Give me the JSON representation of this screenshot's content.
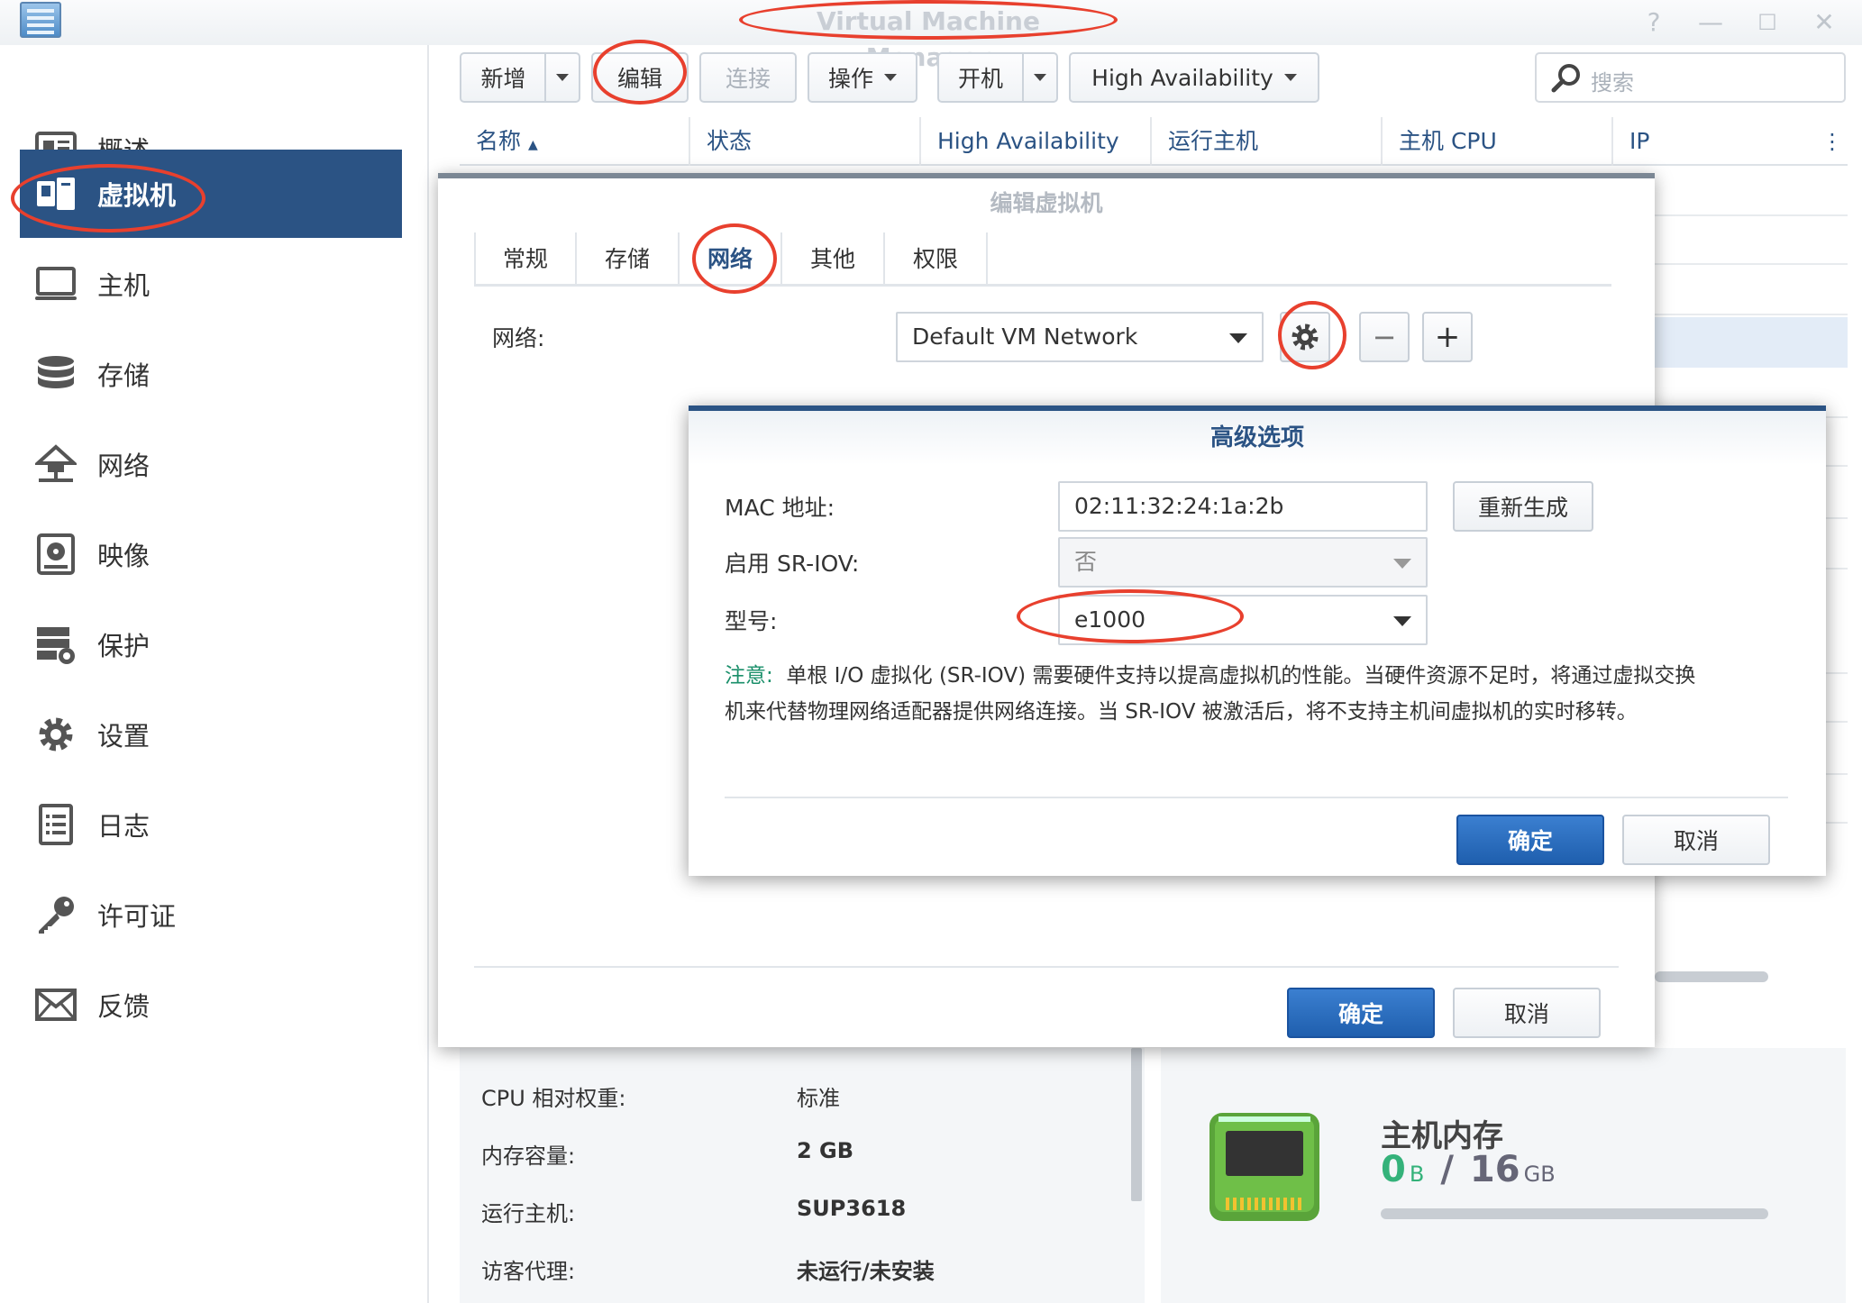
{
  "window": {
    "title": "Virtual Machine Manager",
    "help": "?",
    "minimize": "—",
    "maximize": "☐",
    "close": "✕"
  },
  "sidebar": {
    "items": [
      {
        "label": "概述"
      },
      {
        "label": "虚拟机"
      },
      {
        "label": "主机"
      },
      {
        "label": "存储"
      },
      {
        "label": "网络"
      },
      {
        "label": "映像"
      },
      {
        "label": "保护"
      },
      {
        "label": "设置"
      },
      {
        "label": "日志"
      },
      {
        "label": "许可证"
      },
      {
        "label": "反馈"
      }
    ]
  },
  "toolbar": {
    "add": "新增",
    "edit": "编辑",
    "connect": "连接",
    "action": "操作",
    "power_on": "开机",
    "ha": "High Availability",
    "search_placeholder": "搜索"
  },
  "grid": {
    "columns": [
      "名称",
      "状态",
      "High Availability",
      "运行主机",
      "主机 CPU",
      "IP"
    ],
    "sort_indicator": "▲",
    "more": "⋮"
  },
  "details": {
    "rows": [
      {
        "key": "CPU 相对权重:",
        "value": "标准"
      },
      {
        "key": "内存容量:",
        "value": "2 GB"
      },
      {
        "key": "运行主机:",
        "value": "SUP3618"
      },
      {
        "key": "访客代理:",
        "value": "未运行/未安装"
      }
    ],
    "memory": {
      "title": "主机内存",
      "used": "0",
      "used_unit": "B",
      "sep": "/",
      "total": "16",
      "total_unit": "GB",
      "usage_fraction": 0.0
    }
  },
  "edit_dialog": {
    "title": "编辑虚拟机",
    "tabs": [
      "常规",
      "存储",
      "网络",
      "其他",
      "权限"
    ],
    "network_label": "网络:",
    "network_value": "Default VM Network",
    "ok": "确定",
    "cancel": "取消"
  },
  "advanced_dialog": {
    "title": "高级选项",
    "mac_label": "MAC 地址:",
    "mac_value": "02:11:32:24:1a:2b",
    "regen": "重新生成",
    "sriov_label": "启用 SR-IOV:",
    "sriov_value": "否",
    "model_label": "型号:",
    "model_value": "e1000",
    "note_label": "注意:",
    "note_line1": "单根 I/O 虚拟化 (SR-IOV) 需要硬件支持以提高虚拟机的性能。当硬件资源不足时，将通过虚拟交换",
    "note_line2": "机来代替物理网络适配器提供网络连接。当 SR-IOV 被激活后，将不支持主机间虚拟机的实时移转。",
    "ok": "确定",
    "cancel": "取消"
  },
  "colors": {
    "accent": "#2b5384",
    "primary_button": "#2a6cc0",
    "annotation": "#e8402e",
    "note": "#1a8f6a"
  }
}
